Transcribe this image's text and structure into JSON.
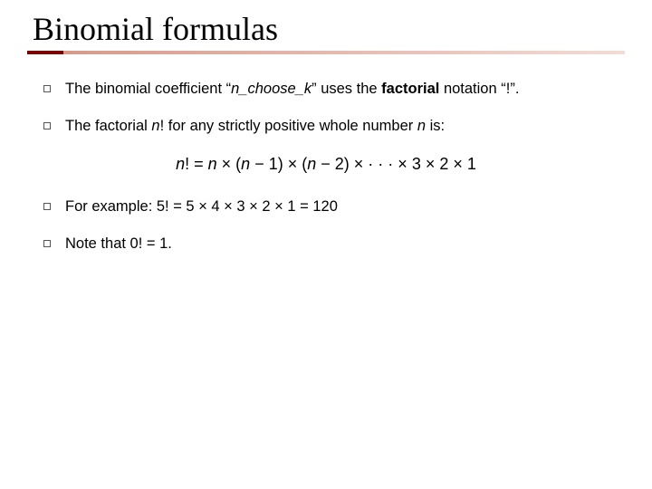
{
  "title": "Binomial formulas",
  "bullets": {
    "b1": {
      "pre": "The binomial coefficient “",
      "var1": "n_choose_k",
      "mid": "” uses the ",
      "bold": "factorial",
      "post": " notation “!”."
    },
    "b2": {
      "pre": "The factorial ",
      "var1": "n",
      "excl": "! for any strictly positive whole number ",
      "var2": "n",
      "post": " is:"
    },
    "b3": {
      "text": "For example: 5! = 5 × 4 × 3 × 2 × 1 = 120"
    },
    "b4": {
      "text": "Note that 0! = 1."
    }
  },
  "formula": {
    "lhs_var": "n",
    "lhs_excl": "!",
    "eq": " = ",
    "n": "n",
    "times": " × ",
    "lp": "(",
    "rp": ")",
    "minus": " − ",
    "one": "1",
    "two": "2",
    "dots": " ·  ·  · ",
    "three": "3"
  }
}
